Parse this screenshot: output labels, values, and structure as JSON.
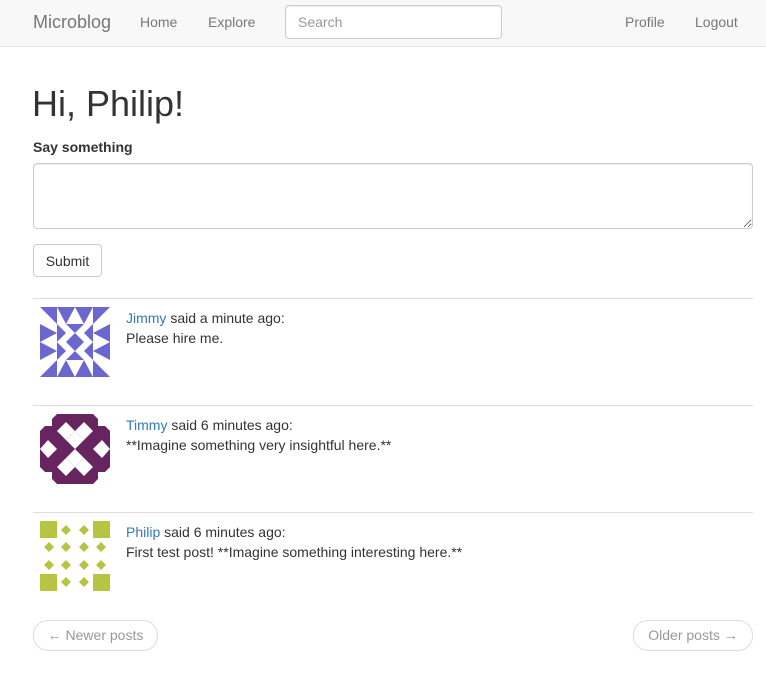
{
  "navbar": {
    "brand": "Microblog",
    "home": "Home",
    "explore": "Explore",
    "search_placeholder": "Search",
    "search_value": "",
    "profile": "Profile",
    "logout": "Logout"
  },
  "greeting": "Hi, Philip!",
  "form": {
    "label": "Say something",
    "textarea_value": "",
    "submit_label": "Submit"
  },
  "posts": [
    {
      "author": "Jimmy",
      "meta": " said a minute ago:",
      "body": "Please hire me.",
      "avatar_color": "#6a67ce"
    },
    {
      "author": "Timmy",
      "meta": " said 6 minutes ago:",
      "body": "**Imagine something very insightful here.**",
      "avatar_color": "#68245f"
    },
    {
      "author": "Philip",
      "meta": " said 6 minutes ago:",
      "body": "First test post! **Imagine something interesting here.**",
      "avatar_color": "#b7c441"
    }
  ],
  "pager": {
    "newer": "← Newer posts",
    "older": "Older posts →"
  }
}
